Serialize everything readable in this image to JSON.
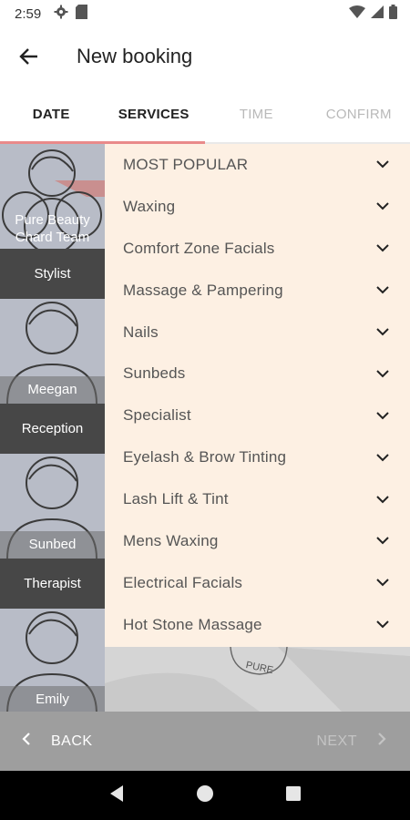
{
  "status_bar": {
    "time": "2:59",
    "icons": [
      "gear-icon",
      "sd-card-icon",
      "wifi-icon",
      "signal-icon",
      "battery-icon"
    ]
  },
  "app_bar": {
    "title": "New booking",
    "back_icon": "arrow-left-icon"
  },
  "tabs": [
    {
      "label": "DATE",
      "state": "enabled"
    },
    {
      "label": "SERVICES",
      "state": "enabled"
    },
    {
      "label": "TIME",
      "state": "disabled"
    },
    {
      "label": "CONFIRM",
      "state": "disabled"
    }
  ],
  "staff": [
    {
      "name": "Pure Beauty Chard Team",
      "role": "Stylist"
    },
    {
      "name": "Meegan",
      "role": "Reception"
    },
    {
      "name": "Sunbed",
      "role": "Therapist"
    },
    {
      "name": "Emily",
      "role": ""
    }
  ],
  "services": [
    "MOST POPULAR",
    "Waxing",
    "Comfort Zone Facials",
    "Massage & Pampering",
    "Nails",
    "Sunbeds",
    "Specialist",
    "Eyelash & Brow Tinting",
    "Lash Lift & Tint",
    "Mens Waxing",
    "Electrical Facials",
    "Hot Stone Massage"
  ],
  "background_logo_text": "PURE",
  "action_bar": {
    "back_label": "BACK",
    "next_label": "NEXT",
    "next_enabled": false
  },
  "colors": {
    "tab_indicator": "#e98a8a",
    "services_bg": "#fdf0e3",
    "role_box": "#474747",
    "action_bar": "#9e9e9e"
  }
}
